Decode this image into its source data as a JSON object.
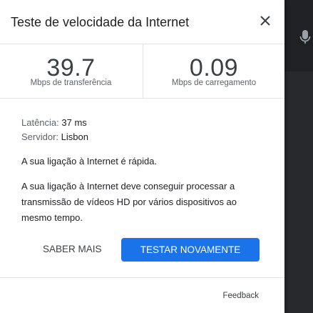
{
  "dialog": {
    "title": "Teste de velocidade da Internet",
    "close_icon": "close-icon"
  },
  "results": {
    "download": {
      "value": "39.7",
      "unit": "Mbps de transferência"
    },
    "upload": {
      "value": "0.09",
      "unit": "Mbps de carregamento"
    }
  },
  "info": {
    "latency_label": "Latência:",
    "latency_value": "37 ms",
    "server_label": "Servidor:",
    "server_value": "Lisbon"
  },
  "messages": {
    "fast": "A sua ligação à Internet é rápida.",
    "description": "A sua ligação à Internet deve conseguir processar a transmissão de vídeos HD por vários dispositivos ao mesmo tempo."
  },
  "actions": {
    "learn_more": "SABER MAIS",
    "retest": "TESTAR NOVAMENTE"
  },
  "footer": {
    "feedback": "Feedback"
  },
  "background": {
    "mic_icon": "microphone-icon"
  },
  "colors": {
    "accent": "#1a73e8",
    "background_dark": "#202124"
  }
}
